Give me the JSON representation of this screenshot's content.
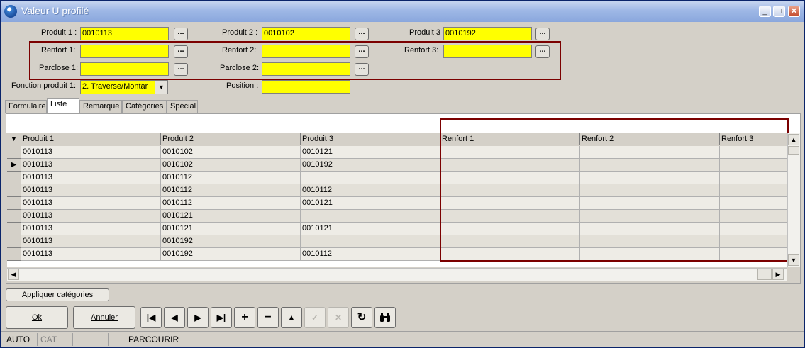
{
  "window": {
    "title": "Valeur U profilé",
    "minimize_glyph": "_",
    "maximize_glyph": "□",
    "close_glyph": "✕"
  },
  "form": {
    "produit1": {
      "label": "Produit 1 :",
      "value": "0010113"
    },
    "produit2": {
      "label": "Produit 2 :",
      "value": "0010102"
    },
    "produit3": {
      "label": "Produit 3",
      "value": "0010192"
    },
    "renfort1": {
      "label": "Renfort 1:",
      "value": ""
    },
    "renfort2": {
      "label": "Renfort 2:",
      "value": ""
    },
    "renfort3": {
      "label": "Renfort 3:",
      "value": ""
    },
    "parclose1": {
      "label": "Parclose 1:",
      "value": ""
    },
    "parclose2": {
      "label": "Parclose 2:",
      "value": ""
    },
    "fonction": {
      "label": "Fonction produit 1:",
      "value": "2. Traverse/Montar"
    },
    "position": {
      "label": "Position :",
      "value": ""
    },
    "browse_label": "..."
  },
  "tabs": [
    "Formulaire",
    "Liste",
    "Remarque",
    "Catégories",
    "Spécial"
  ],
  "active_tab": "Liste",
  "grid": {
    "columns": [
      "Produit 1",
      "Produit 2",
      "Produit 3",
      "Renfort 1",
      "Renfort 2",
      "Renfort 3"
    ],
    "rows": [
      [
        "0010113",
        "0010102",
        "0010121",
        "",
        "",
        ""
      ],
      [
        "0010113",
        "0010102",
        "0010192",
        "",
        "",
        ""
      ],
      [
        "0010113",
        "0010112",
        "",
        "",
        "",
        ""
      ],
      [
        "0010113",
        "0010112",
        "0010112",
        "",
        "",
        ""
      ],
      [
        "0010113",
        "0010112",
        "0010121",
        "",
        "",
        ""
      ],
      [
        "0010113",
        "0010121",
        "",
        "",
        "",
        ""
      ],
      [
        "0010113",
        "0010121",
        "0010121",
        "",
        "",
        ""
      ],
      [
        "0010113",
        "0010192",
        "",
        "",
        "",
        ""
      ],
      [
        "0010113",
        "0010192",
        "0010112",
        "",
        "",
        ""
      ]
    ],
    "current_row": 1
  },
  "buttons": {
    "apply_categories": "Appliquer catégories",
    "ok": "Ok",
    "cancel": "Annuler"
  },
  "status": {
    "mode": "AUTO",
    "cat": "CAT",
    "blank": "",
    "state": "PARCOURIR"
  }
}
